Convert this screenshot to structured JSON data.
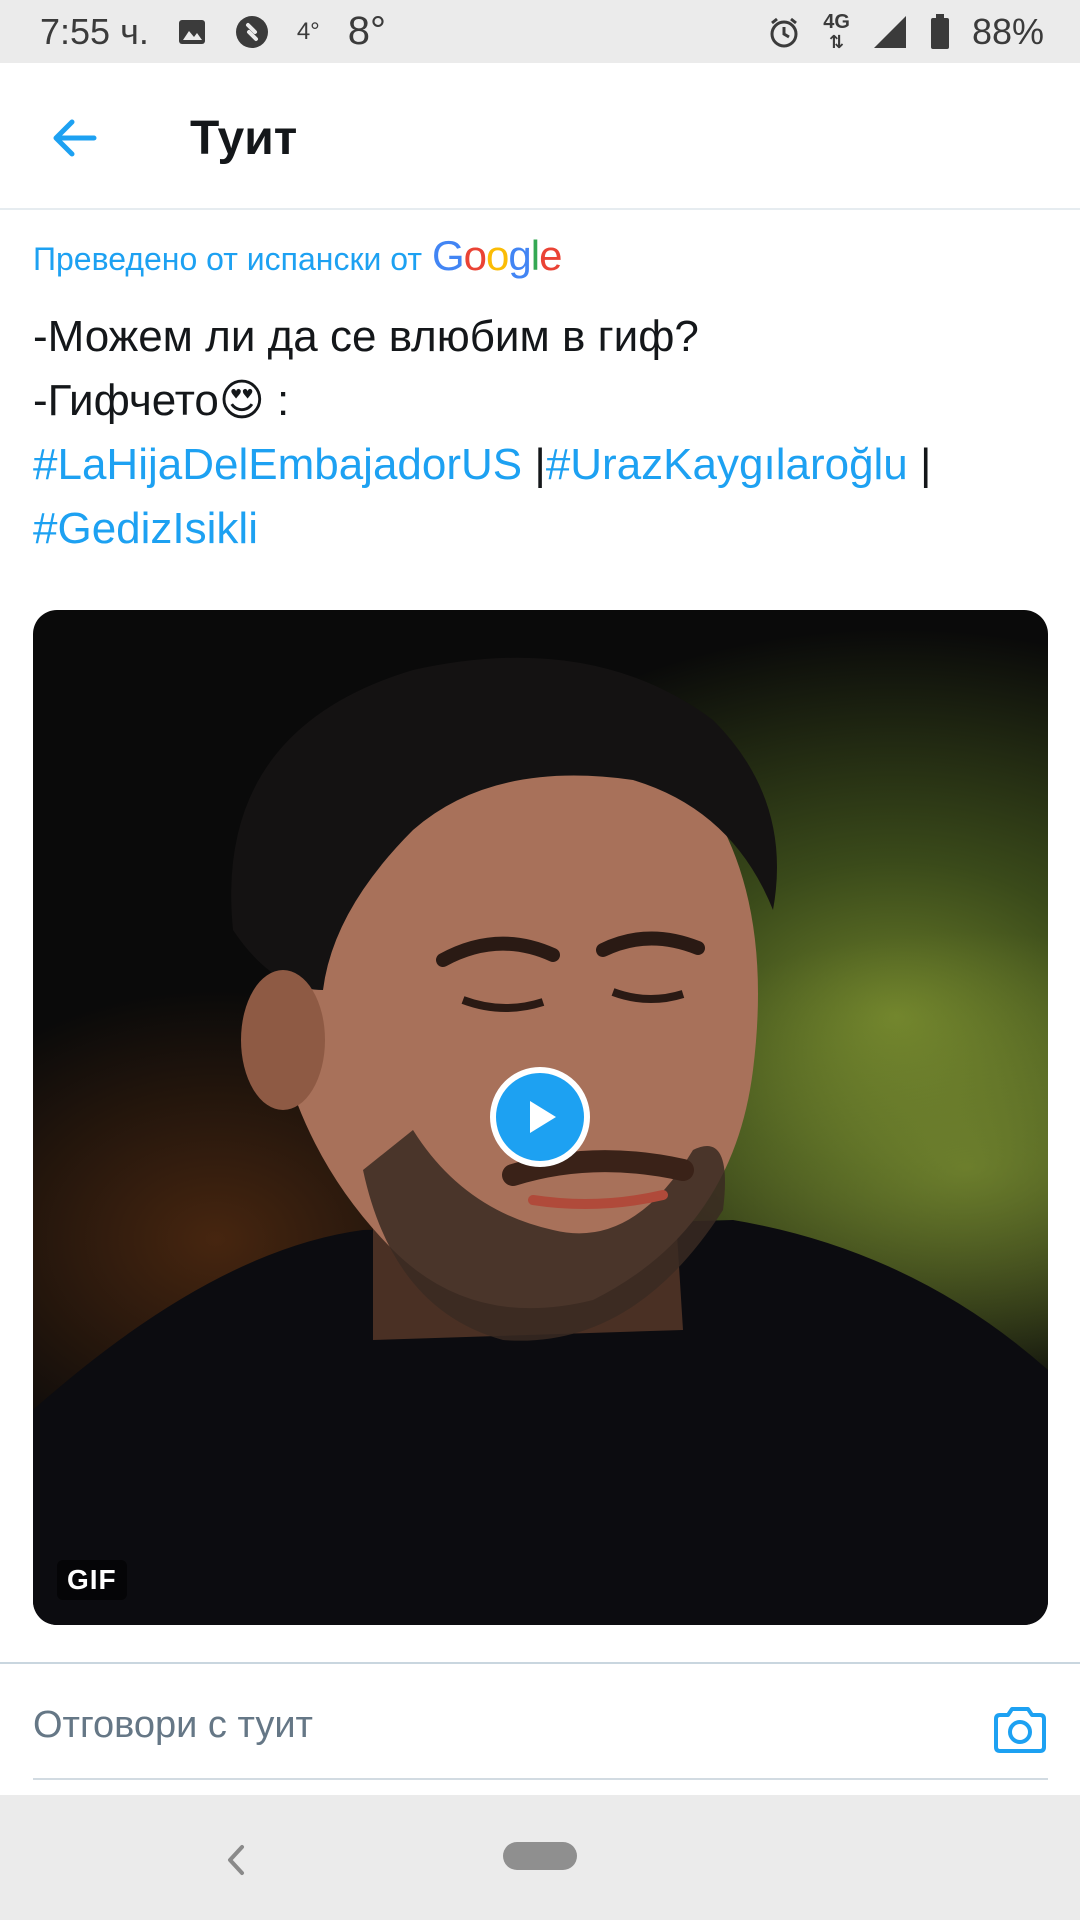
{
  "status_bar": {
    "time": "7:55 ч.",
    "temp_small": "4°",
    "temp_large": "8°",
    "network": "4G",
    "battery": "88%"
  },
  "header": {
    "title": "Туит"
  },
  "translation": {
    "label": "Преведено от испански от",
    "provider": "Google"
  },
  "tweet": {
    "line1": "-Можем ли да се влюбим в гиф?",
    "line2_text": " -Гифчето",
    "line2_emoji": "😍",
    "line2_suffix": " :",
    "hashtags": [
      "#LaHijaDelEmbajadorUS",
      "#UrazKaygılaroğlu",
      "#GedizIsikli"
    ],
    "separator": "|"
  },
  "media": {
    "badge": "GIF"
  },
  "reply": {
    "placeholder": "Отговори с туит"
  },
  "icons": {
    "back": "back-arrow-icon",
    "camera": "camera-icon",
    "play": "play-icon"
  },
  "colors": {
    "accent": "#1da1f2",
    "text": "#14171a",
    "muted": "#657786"
  }
}
